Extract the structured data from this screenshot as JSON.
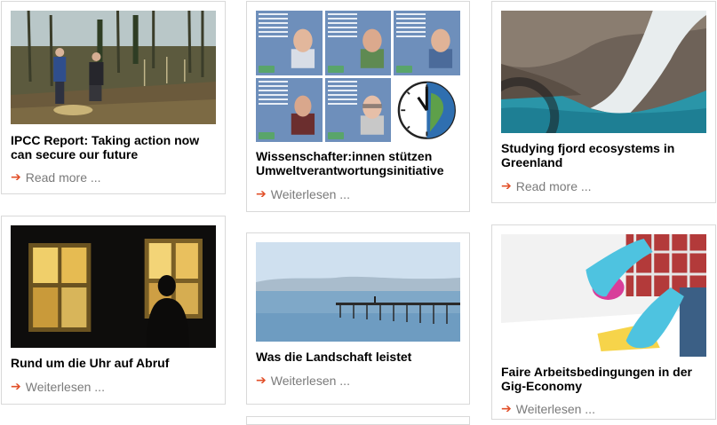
{
  "cards": [
    {
      "title": "IPCC Report: Taking action now can secure our future",
      "link": "Read more ...",
      "image_icon": "forest-clearing-image"
    },
    {
      "title": "Wissenschafter:innen stützen Umweltverantwortungsinitiative",
      "link": "Weiterlesen ...",
      "image_icon": "scientist-portraits-image"
    },
    {
      "title": "Studying fjord ecosystems in Greenland",
      "link": "Read more ...",
      "image_icon": "glacier-fjord-image"
    },
    {
      "title": "Rund um die Uhr auf Abruf",
      "link": "Weiterlesen ...",
      "image_icon": "night-window-silhouette-image"
    },
    {
      "title": "Was die Landschaft leistet",
      "link": "Weiterlesen ...",
      "image_icon": "lake-pier-image"
    },
    {
      "title": "Faire Arbeitsbedingungen in der Gig-Economy",
      "link": "Weiterlesen ...",
      "image_icon": "cleaning-gloves-image"
    }
  ],
  "colors": {
    "arrow": "#e2502a",
    "link_text": "#7a7a7a",
    "border": "#d9d9d9"
  }
}
